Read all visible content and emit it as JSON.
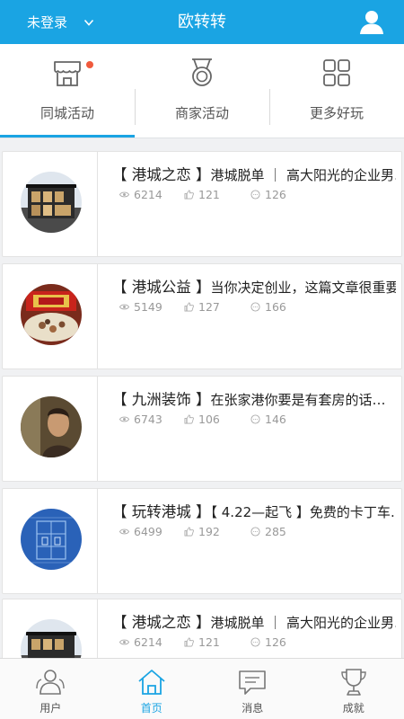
{
  "header": {
    "login_label": "未登录",
    "title": "欧转转",
    "user_icon": "user-icon"
  },
  "tabs": [
    {
      "label": "同城活动",
      "icon": "storefront-icon",
      "active": true,
      "badge": true
    },
    {
      "label": "商家活动",
      "icon": "medal-icon",
      "active": false,
      "badge": false
    },
    {
      "label": "更多好玩",
      "icon": "grid-icon",
      "active": false,
      "badge": false
    }
  ],
  "list": [
    {
      "tag": "【 港城之恋 】",
      "text": "港城脱单 ｜ 高大阳光的企业男…",
      "views": "6214",
      "likes": "121",
      "comments": "126",
      "avatar": "house"
    },
    {
      "tag": "【 港城公益 】",
      "text": "当你决定创业，这篇文章很重要",
      "views": "5149",
      "likes": "127",
      "comments": "166",
      "avatar": "food"
    },
    {
      "tag": "【 九洲装饰 】",
      "text": "在张家港你要是有套房的话…",
      "views": "6743",
      "likes": "106",
      "comments": "146",
      "avatar": "person"
    },
    {
      "tag": "【 玩转港城 】",
      "text": "【 4.22—起飞 】免费的卡丁车…",
      "views": "6499",
      "likes": "192",
      "comments": "285",
      "avatar": "blueprint"
    },
    {
      "tag": "【 港城之恋 】",
      "text": "港城脱单 ｜ 高大阳光的企业男…",
      "views": "6214",
      "likes": "121",
      "comments": "126",
      "avatar": "house"
    }
  ],
  "bottom_nav": [
    {
      "label": "用户",
      "icon": "users-icon",
      "active": false
    },
    {
      "label": "首页",
      "icon": "home-icon",
      "active": true
    },
    {
      "label": "消息",
      "icon": "message-icon",
      "active": false
    },
    {
      "label": "成就",
      "icon": "trophy-icon",
      "active": false
    }
  ],
  "colors": {
    "accent": "#1aa4e3",
    "badge": "#f05a3d",
    "text": "#222222",
    "muted": "#999999"
  }
}
